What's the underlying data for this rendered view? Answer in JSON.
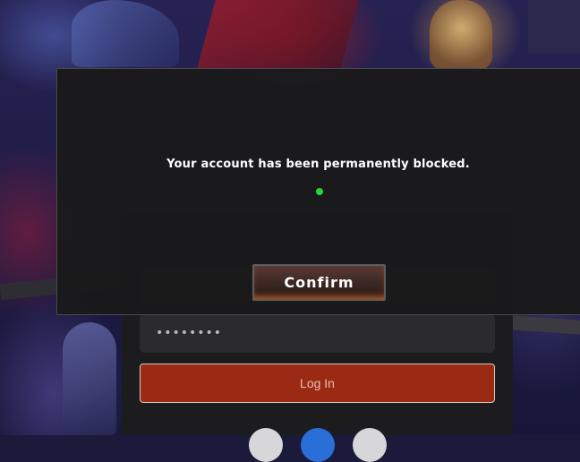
{
  "login": {
    "username_value": "",
    "password_value": "••••••••",
    "login_label": "Log In"
  },
  "modal": {
    "message": "Your account has been permanently blocked.",
    "confirm_label": "Confirm"
  },
  "colors": {
    "confirm_glow": "#e66e28",
    "login_button": "#9a2a14",
    "status_dot": "#28d63a"
  }
}
